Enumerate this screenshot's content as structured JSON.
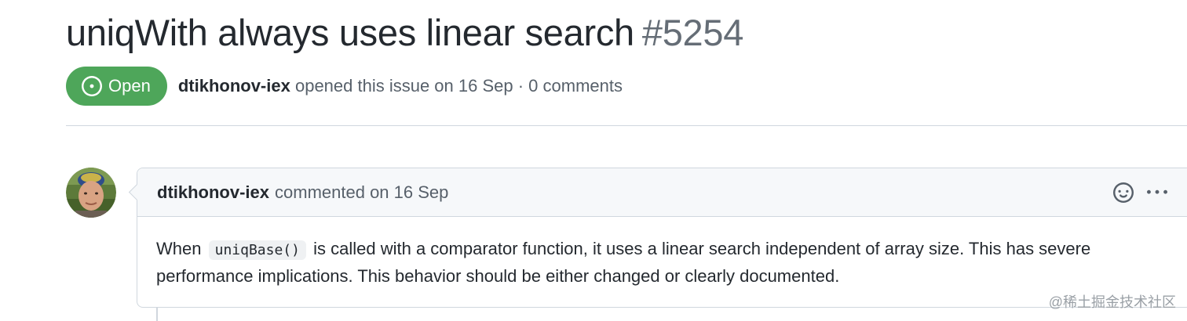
{
  "issue": {
    "title": "uniqWith always uses linear search",
    "number": "#5254",
    "state": "Open",
    "author": "dtikhonov-iex",
    "opened_text": "opened this issue on 16 Sep · 0 comments"
  },
  "comment": {
    "author": "dtikhonov-iex",
    "action_text": "commented on 16 Sep",
    "body_before_code": "When",
    "body_code": "uniqBase()",
    "body_after_code": "is called with a comparator function, it uses a linear search independent of array size. This has severe performance implications. This behavior should be either changed or clearly documented.",
    "icons": [
      "smiley-icon",
      "kebab-menu-icon"
    ]
  },
  "watermark": "@稀土掘金技术社区",
  "colors": {
    "open_badge": "#4ea65a",
    "text_primary": "#24292f",
    "text_muted": "#57606a",
    "border": "#d0d7de",
    "header_bg": "#f6f8fa"
  }
}
